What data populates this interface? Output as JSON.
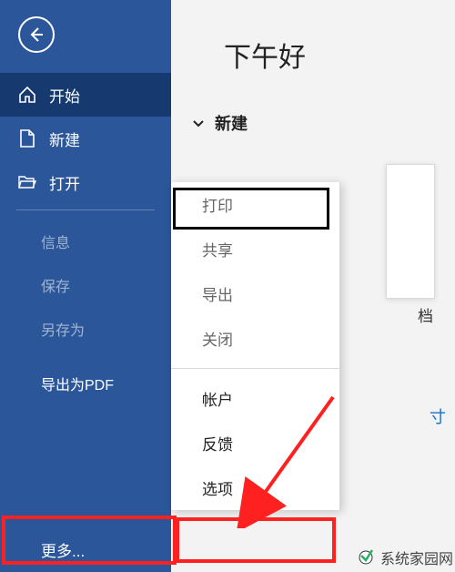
{
  "sidebar": {
    "home": "开始",
    "new": "新建",
    "open": "打开",
    "info": "信息",
    "save": "保存",
    "saveas": "另存为",
    "exportpdf": "导出为PDF",
    "more": "更多..."
  },
  "main": {
    "greeting": "下午好",
    "section_new": "新建",
    "doc_caption": "档"
  },
  "panel": {
    "print": "打印",
    "share": "共享",
    "export": "导出",
    "close": "关闭",
    "account": "帐户",
    "feedback": "反馈",
    "options": "选项"
  },
  "watermark": "系统家园网",
  "cut_text": "寸"
}
